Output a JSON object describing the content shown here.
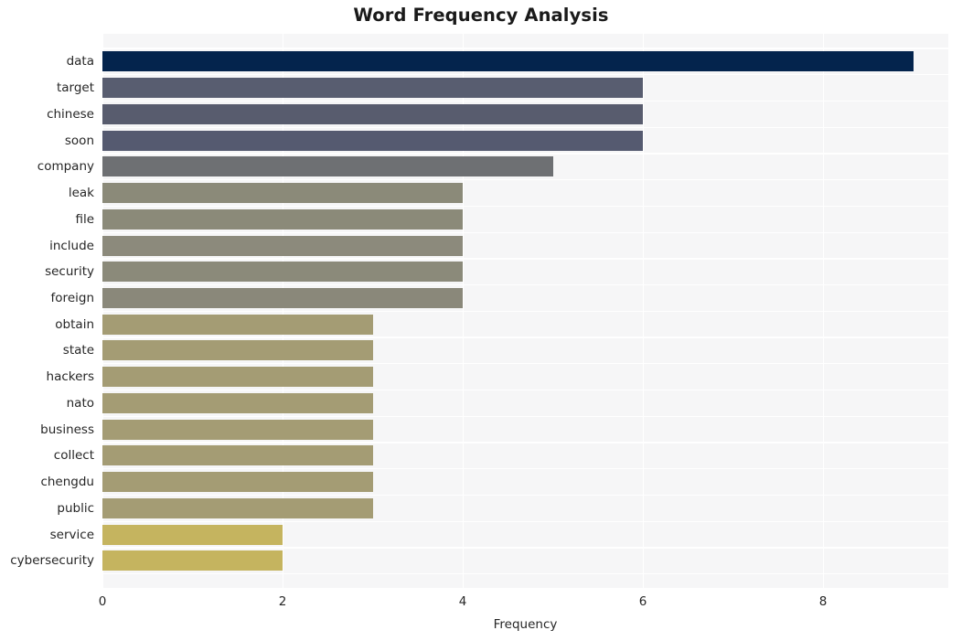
{
  "chart_data": {
    "type": "bar",
    "orientation": "horizontal",
    "title": "Word Frequency Analysis",
    "xlabel": "Frequency",
    "ylabel": "",
    "categories": [
      "data",
      "target",
      "chinese",
      "soon",
      "company",
      "leak",
      "file",
      "include",
      "security",
      "foreign",
      "obtain",
      "state",
      "hackers",
      "nato",
      "business",
      "collect",
      "chengdu",
      "public",
      "service",
      "cybersecurity"
    ],
    "values": [
      9,
      6,
      6,
      6,
      5,
      4,
      4,
      4,
      4,
      4,
      3,
      3,
      3,
      3,
      3,
      3,
      3,
      3,
      2,
      2
    ],
    "bar_colors": [
      "#04244d",
      "#585d70",
      "#585c6e",
      "#555a70",
      "#6e7073",
      "#8b8a79",
      "#8b8a79",
      "#8c8a7c",
      "#8b8a7a",
      "#8a887a",
      "#a49c74",
      "#a49c74",
      "#a49c74",
      "#a49c74",
      "#a49c74",
      "#a49c74",
      "#a49c74",
      "#a49c74",
      "#c5b45f",
      "#c5b45f"
    ],
    "xticks": [
      0,
      2,
      4,
      6,
      8
    ],
    "xlim": [
      0,
      9.39
    ],
    "grid": true,
    "legend": false,
    "plot_background": "#f6f6f7",
    "grid_color": "#ffffff",
    "title_color": "#1a1a1a",
    "tick_label_color": "#262626"
  }
}
